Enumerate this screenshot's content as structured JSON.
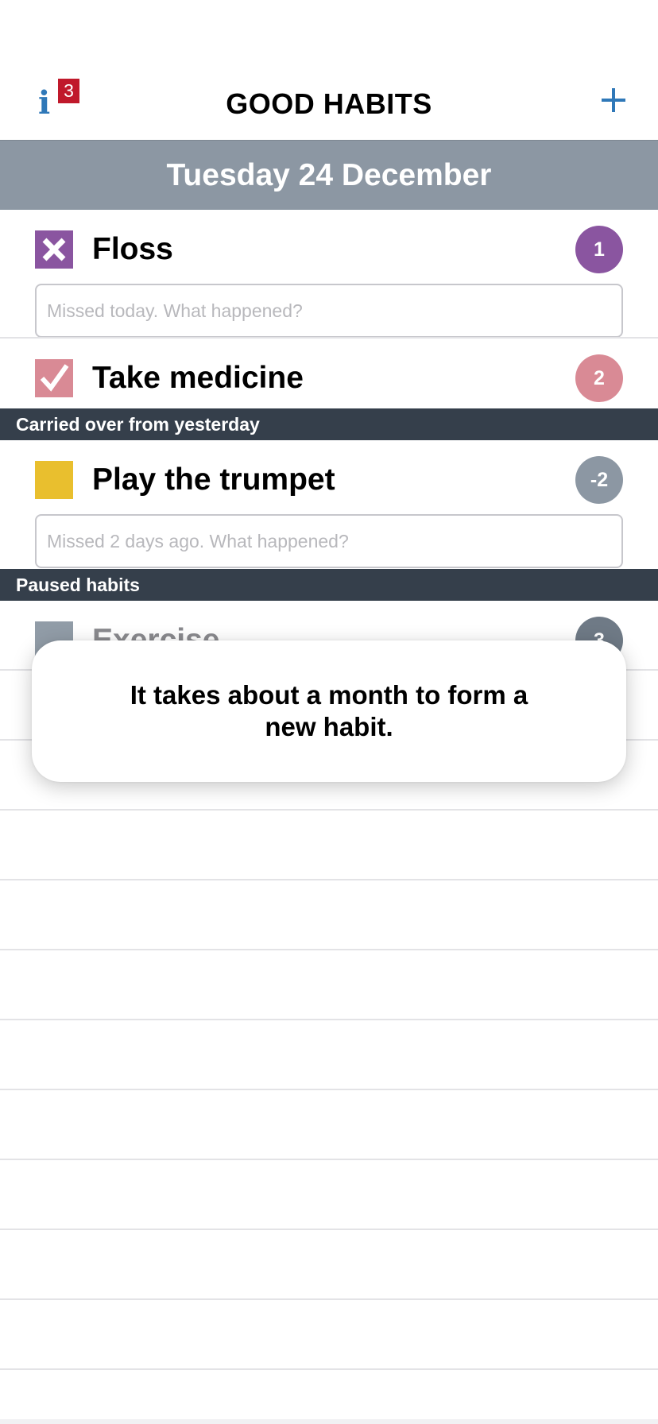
{
  "header": {
    "info_glyph": "i",
    "info_badge_count": "3",
    "title": "GOOD HABITS",
    "add_icon": "plus-icon"
  },
  "date_bar": {
    "label": "Tuesday 24 December"
  },
  "today_habits": [
    {
      "name": "Floss",
      "state": "missed",
      "checkbox_color": "#8a55a0",
      "count": "1",
      "count_color": "#8a55a0",
      "note_placeholder": "Missed today. What happened?"
    },
    {
      "name": "Take medicine",
      "state": "done",
      "checkbox_color": "#d98a95",
      "count": "2",
      "count_color": "#d98a95"
    }
  ],
  "carried_over": {
    "section_label": "Carried over from yesterday",
    "habits": [
      {
        "name": "Play the trumpet",
        "state": "pending",
        "checkbox_color": "#e9bf2e",
        "count": "-2",
        "count_color": "#8c97a3",
        "note_placeholder": "Missed 2 days ago. What happened?"
      }
    ]
  },
  "paused": {
    "section_label": "Paused habits",
    "habits": [
      {
        "name": "Exercise",
        "state": "paused",
        "checkbox_color": "#8c97a3",
        "count": "3",
        "count_color": "#6f7a86"
      }
    ]
  },
  "tip": {
    "text": "It takes about a month to form a new habit."
  }
}
